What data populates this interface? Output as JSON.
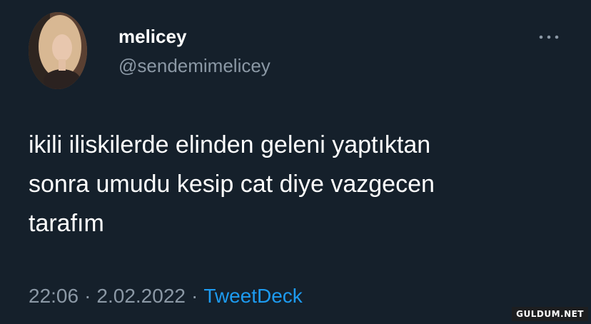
{
  "author": {
    "display_name": "melicey",
    "handle": "@sendemimelicey"
  },
  "tweet": {
    "lines": [
      "ikili iliskilerde elinden geleni yaptıktan",
      "sonra umudu kesip cat diye vazgecen",
      "tarafım"
    ]
  },
  "meta": {
    "time": "22:06",
    "separator": "·",
    "date": "2.02.2022",
    "source": "TweetDeck"
  },
  "icons": {
    "more": "more-horizontal-icon"
  },
  "watermark": "GULDUM.NET",
  "colors": {
    "background": "#15202b",
    "text_primary": "#ffffff",
    "text_secondary": "#8b98a5",
    "link": "#1d9bf0"
  }
}
